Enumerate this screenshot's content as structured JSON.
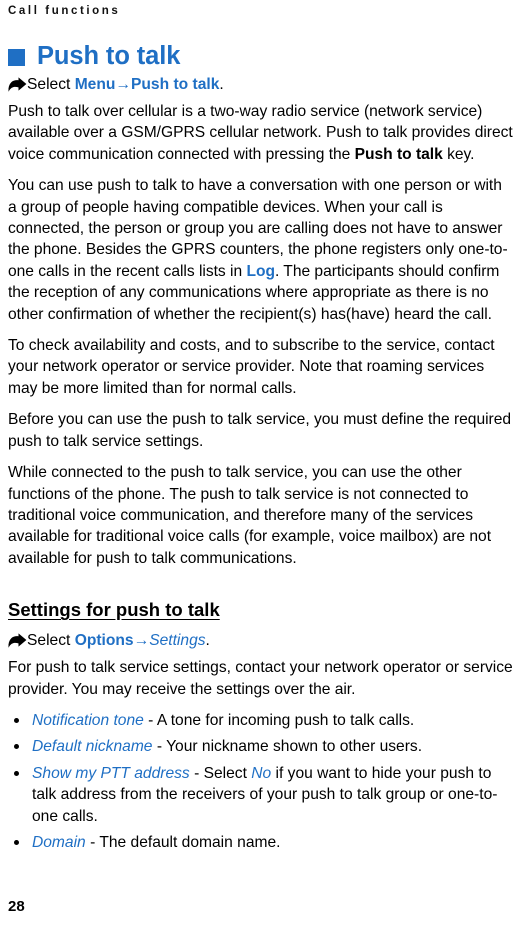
{
  "header": {
    "running_head": "Call functions"
  },
  "chapter": {
    "title": "Push to talk",
    "bullet_icon": "blue-square-icon",
    "accent_color": "#1f6fc4"
  },
  "select_menu": {
    "icon": "arrow-right-icon",
    "prefix": "Select ",
    "item1": "Menu",
    "separator": "→",
    "item2": "Push to talk",
    "suffix": "."
  },
  "paragraphs": {
    "p1_a": "Push to talk over cellular is a two-way radio service (network service) available over a GSM/GPRS cellular network. Push to talk provides direct voice communication connected with pressing the ",
    "p1_key": "Push to talk",
    "p1_b": " key.",
    "p2_a": "You can use push to talk to have a conversation with one person or with a group of people having compatible devices. When your call is connected, the person or group you are calling does not have to answer the phone. Besides the GPRS counters, the phone registers only one-to-one calls in the recent calls lists in ",
    "p2_ref": "Log",
    "p2_b": ". The participants should confirm the reception of any communications where appropriate as there is no other confirmation of whether the recipient(s) has(have) heard the call.",
    "p3": "To check availability and costs, and to subscribe to the service, contact your network operator or service provider. Note that roaming services may be more limited than for normal calls.",
    "p4": "Before you can use the push to talk service, you must define the required push to talk service settings.",
    "p5": "While connected to the push to talk service, you can use the other functions of the phone. The push to talk service is not connected to traditional voice communication, and therefore many of the services available for traditional voice calls (for example, voice mailbox) are not available for push to talk communications."
  },
  "settings_section": {
    "heading": "Settings for push to talk",
    "select_line": {
      "icon": "arrow-right-icon",
      "prefix": "Select ",
      "item1": "Options",
      "separator": "→",
      "item2": "Settings",
      "suffix": "."
    },
    "intro": "For push to talk service settings, contact your network operator or service provider. You may receive the settings over the air.",
    "bullets": [
      {
        "term": "Notification tone",
        "dash": " - ",
        "desc_a": "A tone for incoming push to talk calls.",
        "inline_ref": "",
        "desc_b": ""
      },
      {
        "term": "Default nickname",
        "dash": " - ",
        "desc_a": "Your nickname shown to other users.",
        "inline_ref": "",
        "desc_b": ""
      },
      {
        "term": "Show my PTT address",
        "dash": " - ",
        "desc_a": "Select ",
        "inline_ref": "No",
        "desc_b": " if you want to hide your push to talk address from the receivers of your push to talk group or one-to-one calls."
      },
      {
        "term": "Domain",
        "dash": " - ",
        "desc_a": "The default domain name.",
        "inline_ref": "",
        "desc_b": ""
      }
    ]
  },
  "footer": {
    "page_number": "28"
  }
}
